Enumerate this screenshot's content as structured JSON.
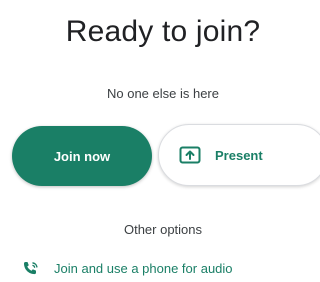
{
  "header": {
    "title": "Ready to join?",
    "subtitle": "No one else is here"
  },
  "actions": {
    "join_label": "Join now",
    "present_label": "Present",
    "present_icon": "present-screen-icon"
  },
  "other_options": {
    "heading": "Other options",
    "phone_label": "Join and use a phone for audio",
    "phone_icon": "phone-audio-icon"
  },
  "colors": {
    "accent": "#1a7f66",
    "text": "#3c4043"
  }
}
